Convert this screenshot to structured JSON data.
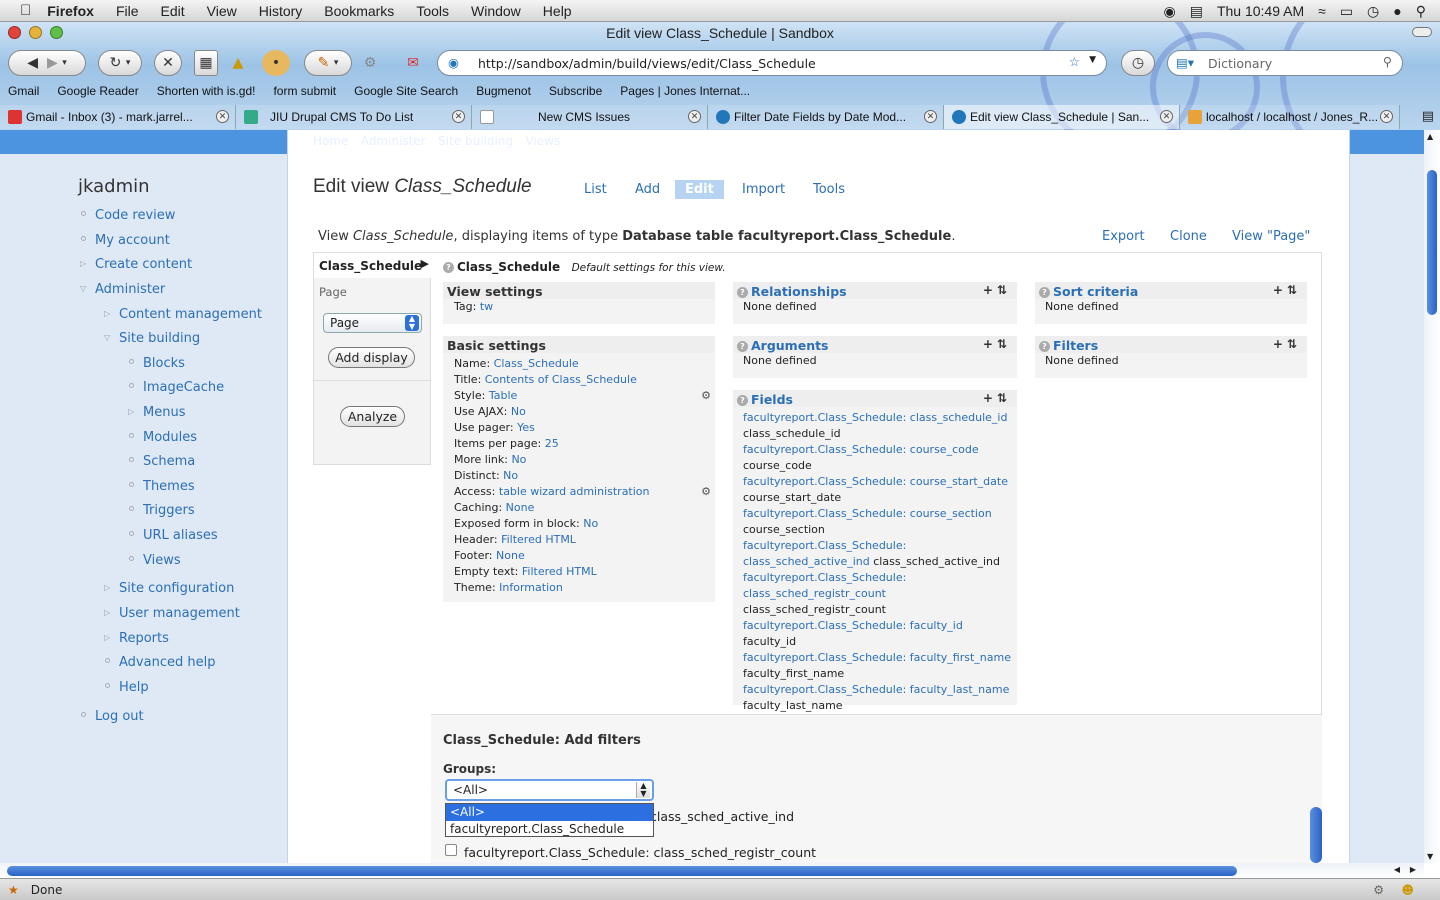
{
  "menubar": {
    "app": "Firefox",
    "items": [
      "File",
      "Edit",
      "View",
      "History",
      "Bookmarks",
      "Tools",
      "Window",
      "Help"
    ],
    "clock": "Thu 10:49 AM"
  },
  "window": {
    "title": "Edit view Class_Schedule | Sandbox"
  },
  "toolbar": {
    "url": "http://sandbox/admin/build/views/edit/Class_Schedule",
    "search_placeholder": "Dictionary"
  },
  "bookmarks": [
    "Gmail",
    "Google Reader",
    "Shorten with is.gd!",
    "form submit",
    "Google Site Search",
    "Bugmenot",
    "Subscribe",
    "Pages | Jones Internat..."
  ],
  "tabs": [
    {
      "label": "Gmail - Inbox (3) - mark.jarrel...",
      "color": "#d33"
    },
    {
      "label": "JIU Drupal CMS To Do List",
      "color": "#3a8"
    },
    {
      "label": "New CMS Issues",
      "color": "#bbb"
    },
    {
      "label": "Filter Date Fields by Date Mod...",
      "color": "#27b"
    },
    {
      "label": "Edit view Class_Schedule | San...",
      "color": "#27b"
    },
    {
      "label": "localhost / localhost / Jones_R...",
      "color": "#e8a23a"
    }
  ],
  "breadcrumb": [
    "Home",
    "Administer",
    "Site building",
    "Views"
  ],
  "site_name": "jkadmin",
  "nav": {
    "code_review": "Code review",
    "my_account": "My account",
    "create_content": "Create content",
    "administer": "Administer",
    "content_management": "Content management",
    "site_building": "Site building",
    "blocks": "Blocks",
    "imagecache": "ImageCache",
    "menus": "Menus",
    "modules": "Modules",
    "schema": "Schema",
    "themes": "Themes",
    "triggers": "Triggers",
    "url_aliases": "URL aliases",
    "views": "Views",
    "site_configuration": "Site configuration",
    "user_management": "User management",
    "reports": "Reports",
    "advanced_help": "Advanced help",
    "help": "Help",
    "log_out": "Log out"
  },
  "page": {
    "title_prefix": "Edit view ",
    "title_name": "Class_Schedule",
    "tabs": [
      "List",
      "Add",
      "Edit",
      "Import",
      "Tools"
    ],
    "view_desc_1": "View ",
    "view_desc_name": "Class_Schedule",
    "view_desc_2": ", displaying items of type ",
    "view_desc_type": "Database table facultyreport.Class_Schedule",
    "view_desc_end": ".",
    "export": "Export",
    "clone": "Clone",
    "view_page": "View \"Page\""
  },
  "displays": {
    "current": "Class_Schedule",
    "page_label": "Page",
    "select_value": "Page",
    "add_display": "Add display",
    "analyze": "Analyze"
  },
  "defaults": {
    "name": "Class_Schedule",
    "note": "Default settings for this view."
  },
  "view_settings": {
    "title": "View settings",
    "tag_label": "Tag:",
    "tag_value": "tw"
  },
  "basic_settings": {
    "title": "Basic settings",
    "rows": [
      {
        "label": "Name:",
        "value": "Class_Schedule"
      },
      {
        "label": "Title:",
        "value": "Contents of Class_Schedule"
      },
      {
        "label": "Style:",
        "value": "Table"
      },
      {
        "label": "Use AJAX:",
        "value": "No"
      },
      {
        "label": "Use pager:",
        "value": "Yes"
      },
      {
        "label": "Items per page:",
        "value": "25"
      },
      {
        "label": "More link:",
        "value": "No"
      },
      {
        "label": "Distinct:",
        "value": "No"
      },
      {
        "label": "Access:",
        "value": "table wizard administration"
      },
      {
        "label": "Caching:",
        "value": "None"
      },
      {
        "label": "Exposed form in block:",
        "value": "No"
      },
      {
        "label": "Header:",
        "value": "Filtered HTML"
      },
      {
        "label": "Footer:",
        "value": "None"
      },
      {
        "label": "Empty text:",
        "value": "Filtered HTML"
      },
      {
        "label": "Theme:",
        "value": "Information"
      }
    ]
  },
  "relationships": {
    "title": "Relationships",
    "empty": "None defined"
  },
  "arguments": {
    "title": "Arguments",
    "empty": "None defined"
  },
  "sort_criteria": {
    "title": "Sort criteria",
    "empty": "None defined"
  },
  "filters": {
    "title": "Filters",
    "empty": "None defined"
  },
  "fields": {
    "title": "Fields",
    "lines": [
      {
        "link": "facultyreport.Class_Schedule: class_schedule_id",
        "text": ""
      },
      {
        "link": "",
        "text": "class_schedule_id"
      },
      {
        "link": "facultyreport.Class_Schedule: course_code",
        "text": ""
      },
      {
        "link": "",
        "text": "course_code"
      },
      {
        "link": "facultyreport.Class_Schedule: course_start_date",
        "text": ""
      },
      {
        "link": "",
        "text": "course_start_date"
      },
      {
        "link": "facultyreport.Class_Schedule: course_section",
        "text": ""
      },
      {
        "link": "",
        "text": "course_section"
      },
      {
        "link": "facultyreport.Class_Schedule:",
        "text": ""
      },
      {
        "link": "class_sched_active_ind",
        "text": " class_sched_active_ind"
      },
      {
        "link": "facultyreport.Class_Schedule:",
        "text": ""
      },
      {
        "link": "class_sched_registr_count",
        "text": ""
      },
      {
        "link": "",
        "text": "class_sched_registr_count"
      },
      {
        "link": "facultyreport.Class_Schedule: faculty_id",
        "text": " faculty_id"
      },
      {
        "link": "facultyreport.Class_Schedule: faculty_first_name",
        "text": ""
      },
      {
        "link": "",
        "text": "faculty_first_name"
      },
      {
        "link": "facultyreport.Class_Schedule: faculty_last_name",
        "text": ""
      },
      {
        "link": "",
        "text": "faculty_last_name"
      }
    ]
  },
  "add_filters": {
    "title": "Class_Schedule: Add filters",
    "groups_label": "Groups:",
    "groups_value": "<All>",
    "options": [
      "<All>",
      "facultyreport.Class_Schedule"
    ],
    "row1_tail": "class_sched_active_ind",
    "row2": "facultyreport.Class_Schedule: class_sched_registr_count"
  },
  "statusbar": {
    "text": "Done"
  }
}
